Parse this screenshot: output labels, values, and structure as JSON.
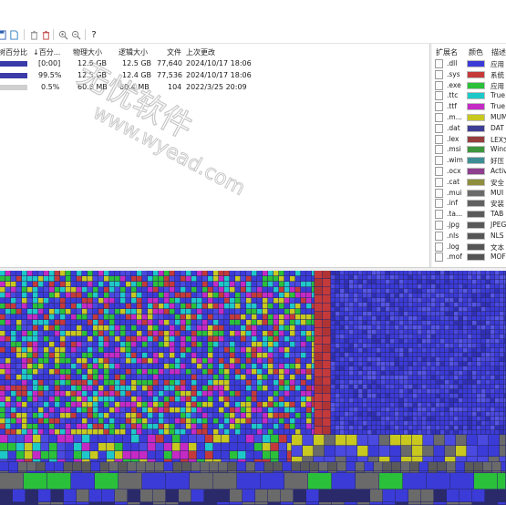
{
  "colors": {
    "accent_blue": "#3b3be0",
    "treemap_bg": "#2a2a6a",
    "watermark": "#c8c8c8"
  },
  "toolbar": {
    "icons": [
      "file-icon",
      "copy-icon",
      "delete-icon",
      "delete-permanent-icon",
      "zoom-in-icon",
      "zoom-out-icon",
      "help-icon"
    ],
    "help_label": "?"
  },
  "file_list": {
    "columns": {
      "percent_bar": "树百分比",
      "percent": "↓百分...",
      "physical_size": "物理大小",
      "logical_size": "逻辑大小",
      "files": "文件",
      "last_modified": "上次更改"
    },
    "rows": [
      {
        "bar_color": "#3a3aa8",
        "percent": "[0:00]",
        "physical_size": "12.5 GB",
        "logical_size": "12.5 GB",
        "files": "77,640",
        "last_modified": "2024/10/17  18:06"
      },
      {
        "bar_color": "#3a3aa8",
        "percent": "99.5%",
        "physical_size": "12.5 GB",
        "logical_size": "12.4 GB",
        "files": "77,536",
        "last_modified": "2024/10/17  18:06"
      },
      {
        "bar_color": "#cfcfcf",
        "percent": "0.5%",
        "physical_size": "60.6 MB",
        "logical_size": "60.4 MB",
        "files": "104",
        "last_modified": "2022/3/25  20:09"
      }
    ]
  },
  "watermark": {
    "line1": "无忧软件",
    "line2": "www.wyead.com"
  },
  "extension_list": {
    "columns": {
      "extension": "扩展名",
      "color": "颜色",
      "description": "描述"
    },
    "rows": [
      {
        "ext": ".dll",
        "color": "#3b3bd8",
        "desc": "应用"
      },
      {
        "ext": ".sys",
        "color": "#c43a3a",
        "desc": "系统"
      },
      {
        "ext": ".exe",
        "color": "#2ac03a",
        "desc": "应用"
      },
      {
        "ext": ".ttc",
        "color": "#1fc8c8",
        "desc": "True"
      },
      {
        "ext": ".ttf",
        "color": "#c42ac4",
        "desc": "True"
      },
      {
        "ext": ".m...",
        "color": "#c8c81f",
        "desc": "MUM"
      },
      {
        "ext": ".dat",
        "color": "#3e3e96",
        "desc": "DAT"
      },
      {
        "ext": ".lex",
        "color": "#963e3e",
        "desc": "LEX文"
      },
      {
        "ext": ".msi",
        "color": "#3e963e",
        "desc": "Wind"
      },
      {
        "ext": ".wim",
        "color": "#3e8e96",
        "desc": "好压"
      },
      {
        "ext": ".ocx",
        "color": "#8e3e8e",
        "desc": "Activ"
      },
      {
        "ext": ".cat",
        "color": "#8e8e3e",
        "desc": "安全"
      },
      {
        "ext": ".mui",
        "color": "#6a6a6a",
        "desc": "MUI"
      },
      {
        "ext": ".inf",
        "color": "#606060",
        "desc": "安装"
      },
      {
        "ext": ".ta...",
        "color": "#5a5a5a",
        "desc": "TAB"
      },
      {
        "ext": ".jpg",
        "color": "#585858",
        "desc": "JPEG"
      },
      {
        "ext": ".nls",
        "color": "#565656",
        "desc": "NLS"
      },
      {
        "ext": ".log",
        "color": "#555555",
        "desc": "文本"
      },
      {
        "ext": ".mof",
        "color": "#545454",
        "desc": "MOF"
      }
    ]
  },
  "treemap": {
    "palette": [
      "#3b3bd8",
      "#c43a3a",
      "#2ac03a",
      "#1fc8c8",
      "#c42ac4",
      "#c8c81f",
      "#3e3e96",
      "#6a6a6a"
    ]
  }
}
